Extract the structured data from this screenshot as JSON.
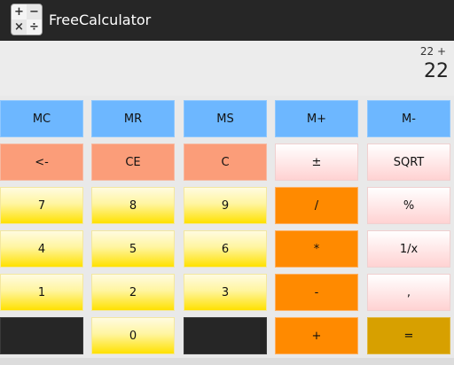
{
  "app": {
    "title": "FreeCalculator",
    "icon_glyphs": [
      "+",
      "−",
      "×",
      "÷"
    ]
  },
  "display": {
    "expression": "22 +",
    "value": "22"
  },
  "keys": {
    "mc": "MC",
    "mr": "MR",
    "ms": "MS",
    "m_plus": "M+",
    "m_minus": "M-",
    "backspace": "<-",
    "ce": "CE",
    "c": "C",
    "plus_minus": "±",
    "sqrt": "SQRT",
    "seven": "7",
    "eight": "8",
    "nine": "9",
    "divide": "/",
    "percent": "%",
    "four": "4",
    "five": "5",
    "six": "6",
    "multiply": "*",
    "reciprocal": "1/x",
    "one": "1",
    "two": "2",
    "three": "3",
    "subtract": "-",
    "comma": ",",
    "zero": "0",
    "add": "+",
    "equals": "="
  },
  "colors": {
    "memory": "#6db7ff",
    "edit": "#fb9d79",
    "function": "#ffd2d2",
    "digit": "#ffe100",
    "operator": "#ff8a00",
    "equals": "#d7a000",
    "titlebar": "#262626"
  }
}
